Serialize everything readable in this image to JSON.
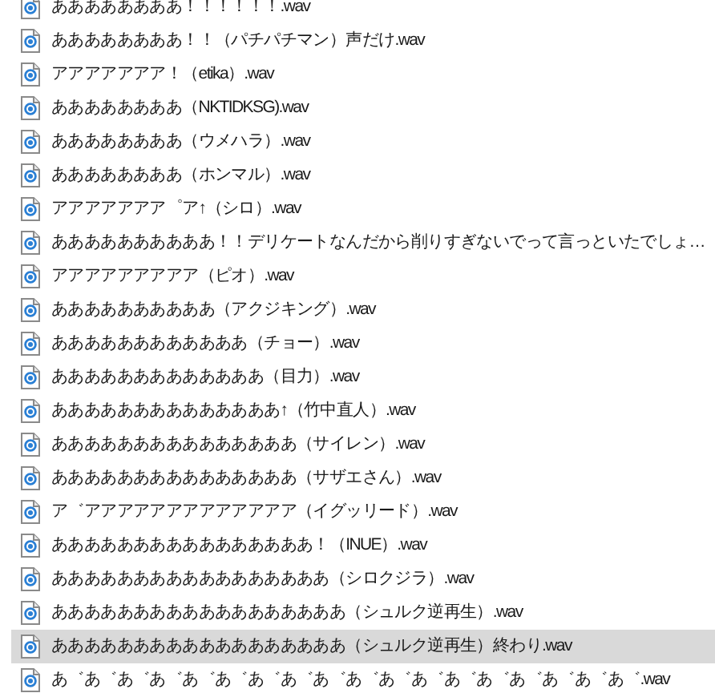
{
  "files": [
    {
      "name": "ああああああああ！！！！！！.wav",
      "selected": false
    },
    {
      "name": "ああああああああ！！（パチパチマン）声だけ.wav",
      "selected": false
    },
    {
      "name": "アアアアアアア！（etika）.wav",
      "selected": false
    },
    {
      "name": "ああああああああ（NKTIDKSG).wav",
      "selected": false
    },
    {
      "name": "ああああああああ（ウメハラ）.wav",
      "selected": false
    },
    {
      "name": "ああああああああ（ホンマル）.wav",
      "selected": false
    },
    {
      "name": "アアアアアアア゜ア↑（シロ）.wav",
      "selected": false
    },
    {
      "name": "ああああああああああ！！デリケートなんだから削りすぎないでって言っといたでしょ…",
      "selected": false
    },
    {
      "name": "アアアアアアアアア（ピオ）.wav",
      "selected": false
    },
    {
      "name": "ああああああああああ（アクジキング）.wav",
      "selected": false
    },
    {
      "name": "ああああああああああああ（チョー）.wav",
      "selected": false
    },
    {
      "name": "あああああああああああああ（目力）.wav",
      "selected": false
    },
    {
      "name": "ああああああああああああああ↑（竹中直人）.wav",
      "selected": false
    },
    {
      "name": "あああああああああああああああ（サイレン）.wav",
      "selected": false
    },
    {
      "name": "あああああああああああああああ（サザエさん）.wav",
      "selected": false
    },
    {
      "name": "ア゛アアアアアアアアアアアアア（イグッリード）.wav",
      "selected": false
    },
    {
      "name": "ああああああああああああああああ！（INUE）.wav",
      "selected": false
    },
    {
      "name": "あああああああああああああああああ（シロクジラ）.wav",
      "selected": false
    },
    {
      "name": "ああああああああああああああああああ（シュルク逆再生）.wav",
      "selected": false
    },
    {
      "name": "ああああああああああああああああああ（シュルク逆再生）終わり.wav",
      "selected": true
    },
    {
      "name": "あ゛あ゛あ゛あ゛あ゛あ゛あ゛あ゛あ゛あ゛あ゛あ゛あ゛あ゛あ゛あ゛あ゛あ゛.wav",
      "selected": false
    }
  ]
}
